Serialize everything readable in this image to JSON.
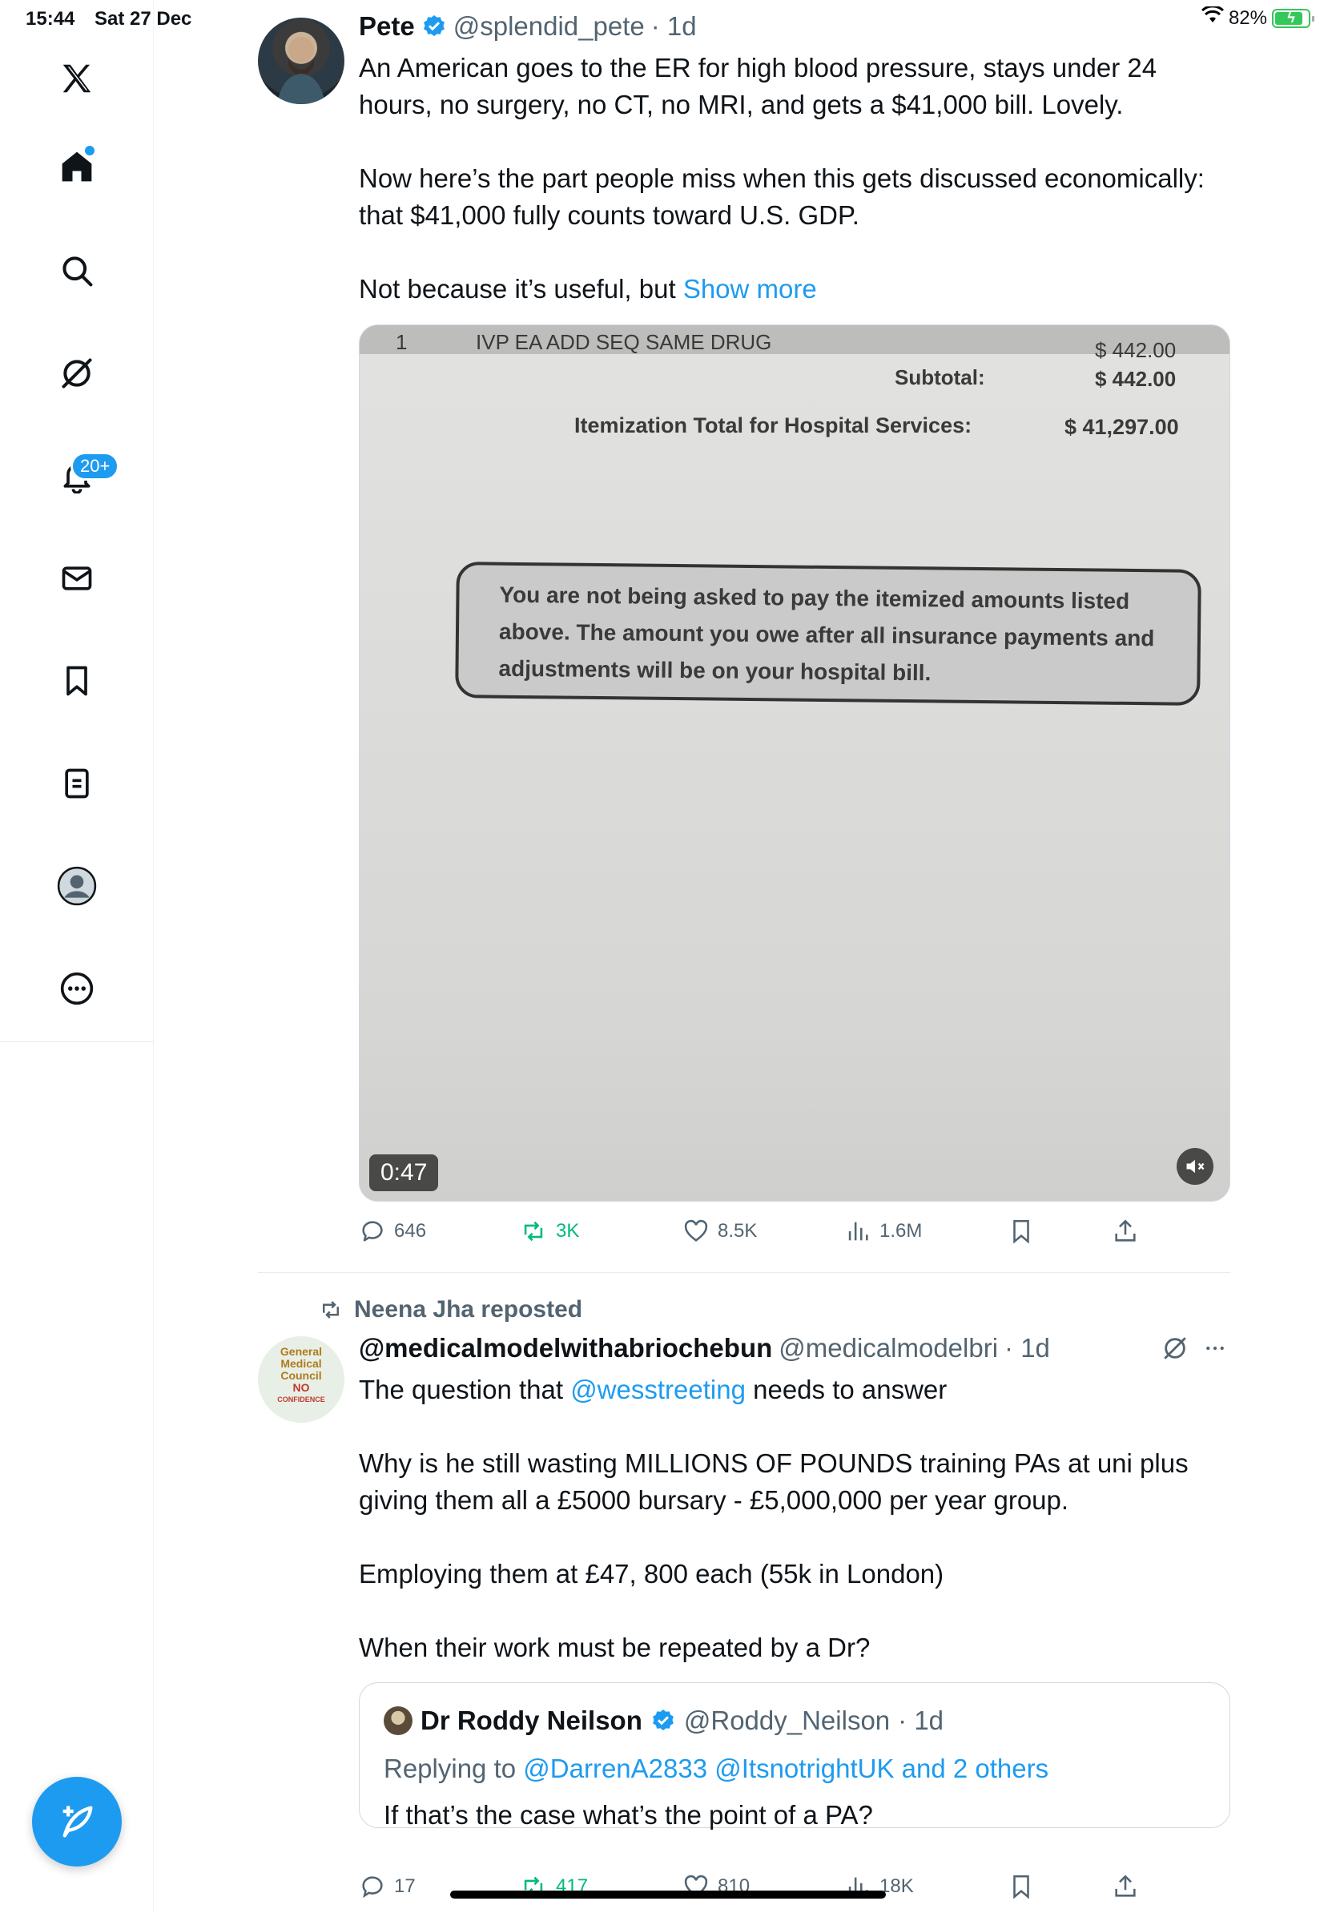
{
  "status": {
    "time": "15:44",
    "date": "Sat 27 Dec",
    "battery": "82%"
  },
  "sidebar": {
    "notifications_badge": "20+",
    "items": [
      "x-logo",
      "home",
      "search",
      "grok",
      "notifications",
      "messages",
      "bookmarks",
      "lists",
      "profile",
      "more"
    ]
  },
  "tweet1": {
    "name": "Pete",
    "handle": "@splendid_pete",
    "time": "· 1d",
    "text": "An American goes to the ER for high blood pressure, stays under 24 hours, no surgery, no CT, no MRI, and gets a $41,000 bill. Lovely.\n\nNow here’s the part people miss when this gets discussed economically: that $41,000 fully counts toward U.S. GDP.\n\nNot because it’s useful, but ",
    "show_more": "Show more",
    "media": {
      "row_qty": "1",
      "row_item": "IVP EA ADD SEQ SAME DRUG",
      "row_amount": "$ 442.00",
      "subtotal_label": "Subtotal:",
      "subtotal_value": "$ 442.00",
      "total_label": "Itemization Total for Hospital Services:",
      "total_value": "$ 41,297.00",
      "notice": "You are not being asked to pay the itemized amounts listed above. The amount you owe after all insurance payments and adjustments will be on your hospital bill.",
      "duration": "0:47"
    },
    "stats": {
      "replies": "646",
      "reposts": "3K",
      "likes": "8.5K",
      "views": "1.6M"
    }
  },
  "tweet2": {
    "reposted_by": "Neena Jha reposted",
    "name": "@medicalmodelwithabriochebun",
    "handle": "@medicalmodelbri",
    "time": "· 1d",
    "text_pre": "The question that ",
    "mention": "@wesstreeting",
    "text_post": " needs to answer",
    "text_body": "Why is he still wasting MILLIONS OF POUNDS training PAs at uni plus giving them all a  £5000 bursary - £5,000,000 per year group.\n\nEmploying them at £47, 800 each (55k in London)\n\nWhen their work must be repeated by a Dr?",
    "avatar_lines": [
      "General",
      "Medical",
      "Council",
      "NO",
      "CONFIDENCE"
    ],
    "quote": {
      "name": "Dr Roddy Neilson",
      "handle": "@Roddy_Neilson",
      "time": "· 1d",
      "reply_prefix": "Replying to",
      "reply_to": "@DarrenA2833 @ItsnotrightUK and 2 others",
      "text": "If that’s the case what’s the point of a PA?"
    },
    "stats": {
      "replies": "17",
      "reposts": "417",
      "likes": "810",
      "views": "18K"
    }
  },
  "colors": {
    "accent": "#1d9bf0",
    "repost_green": "#00ba7c",
    "muted": "#536471"
  }
}
